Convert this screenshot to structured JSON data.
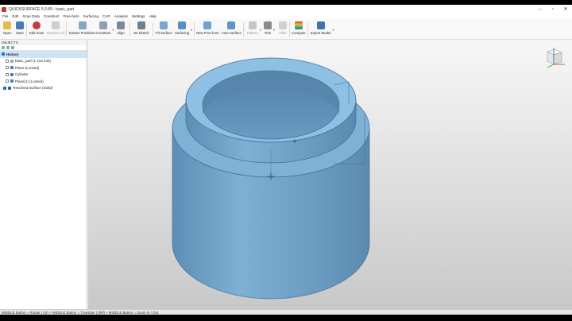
{
  "window": {
    "title": "QUICKSURFACE 5.0.89 - basic_part"
  },
  "menu": [
    "File",
    "Edit",
    "Scan Data",
    "Construct",
    "Free-form",
    "Surfacing",
    "CAD",
    "Analysis",
    "Settings",
    "Help"
  ],
  "toolbar": {
    "open": "Open",
    "save": "Save",
    "edit_scan": "Edit Scan",
    "deselect_all": "Deselect All",
    "extract_primitives": "Extract Primitives",
    "construct": "Construct",
    "align": "Align",
    "sketch_2d": "2D Sketch",
    "fit_surface": "Fit Surface",
    "surfacing": "Surfacing",
    "new_free_form": "New Free-form",
    "auto_surface": "Auto Surface",
    "pattern": "Pattern",
    "trim": "Trim",
    "fillet": "Fillet",
    "compare": "Compare",
    "export_model": "Export Model"
  },
  "sidebar": {
    "header": "OBJECTS",
    "history": "History",
    "items": [
      {
        "label": "basic_part (1 213 440)"
      },
      {
        "label": "Plane (Locked)"
      },
      {
        "label": "Cylinder"
      },
      {
        "label": "Plane(1) (Locked)"
      },
      {
        "label": "Revolved Surface (Solid)"
      }
    ]
  },
  "status": {
    "text": "MIDDLE Button = Rotate | Ctrl + MIDDLE Button = Translate | Shift + MIDDLE Button = Zoom In / Out"
  },
  "colors": {
    "model": "#6c9dc2",
    "selection": "#cfe3f6",
    "accent": "#1f73c4"
  },
  "icons": {
    "view_cube": "view-cube-icon"
  }
}
